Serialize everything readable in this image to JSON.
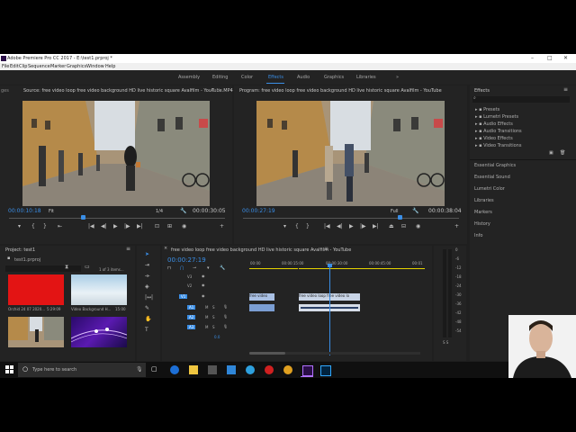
{
  "window": {
    "title": "Adobe Premiere Pro CC 2017 - E:\\test1.prproj *"
  },
  "menu": [
    "File",
    "Edit",
    "Clip",
    "Sequence",
    "Marker",
    "Graphics",
    "Window",
    "Help"
  ],
  "workspaces": [
    "Assembly",
    "Editing",
    "Color",
    "Effects",
    "Audio",
    "Graphics",
    "Libraries"
  ],
  "workspace_active": "Effects",
  "source": {
    "left_tab": "ges",
    "title": "Source: free video loop free video background HD live historic square Avalfilm - YouTube.MP4",
    "extra_tab": "Aud",
    "timecode": "00:00:10:18",
    "fit": "Fit",
    "ratio": "1/4",
    "duration": "00:00:30:05"
  },
  "program": {
    "title": "Program: free video loop free video background HD live historic square Avalfilm - YouTube",
    "timecode": "00:00:27:19",
    "fit": "Full",
    "duration": "00:00:38:04"
  },
  "effects_panel": {
    "title": "Effects",
    "items": [
      "Presets",
      "Lumetri Presets",
      "Audio Effects",
      "Audio Transitions",
      "Video Effects",
      "Video Transitions"
    ],
    "sections": [
      "Essential Graphics",
      "Essential Sound",
      "Lumetri Color",
      "Libraries",
      "Markers",
      "History",
      "Info"
    ]
  },
  "project": {
    "title": "Project: test1",
    "file": "test1.prproj",
    "count": "1 of 3 items...",
    "thumbs": [
      {
        "name": "Orchid 24 07 2020...",
        "duration": "5:29:09"
      },
      {
        "name": "Video Background H...",
        "duration": "15:00"
      }
    ]
  },
  "timeline": {
    "title": "free video loop free video background HD live historic square Avalfilm - YouTube",
    "timecode": "00:00:27:19",
    "ruler": [
      "00:00",
      "00:00:15:00",
      "00:00:30:00",
      "00:00:45:00",
      "00:01"
    ],
    "tracks": [
      "V3",
      "V2",
      "V1",
      "A1",
      "A2",
      "A3"
    ],
    "clip1_label": "free video",
    "clip2_label": "free video loop free video lo",
    "master": "0.0"
  },
  "meter": [
    "0",
    "-6",
    "-12",
    "-18",
    "-24",
    "-30",
    "-36",
    "-42",
    "-48",
    "-54"
  ],
  "meter_footer": "S  S",
  "taskbar": {
    "search_placeholder": "Type here to search"
  },
  "colors": {
    "accent": "#3a8ee6",
    "red_clip": "#e31414"
  }
}
